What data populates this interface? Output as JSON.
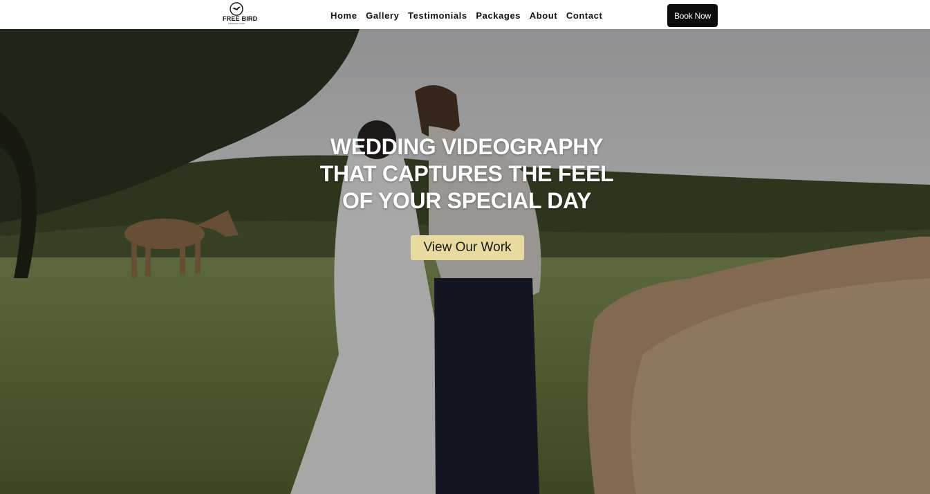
{
  "header": {
    "logo": {
      "text": "FREE BIRD",
      "subtext": "WEDDING FILMS"
    },
    "nav": [
      "Home",
      "Gallery",
      "Testimonials",
      "Packages",
      "About",
      "Contact"
    ],
    "book_label": "Book Now"
  },
  "hero": {
    "headline": [
      "WEDDING VIDEOGRAPHY",
      "THAT CAPTURES THE FEEL",
      "OF YOUR SPECIAL DAY"
    ],
    "cta_label": "View Our Work",
    "image_subject": "couple kissing in a paddock with a horse and highland cattle"
  },
  "colors": {
    "cta_background": "#e8dba0",
    "book_background": "#0c0c0c",
    "nav_text": "#111111"
  }
}
